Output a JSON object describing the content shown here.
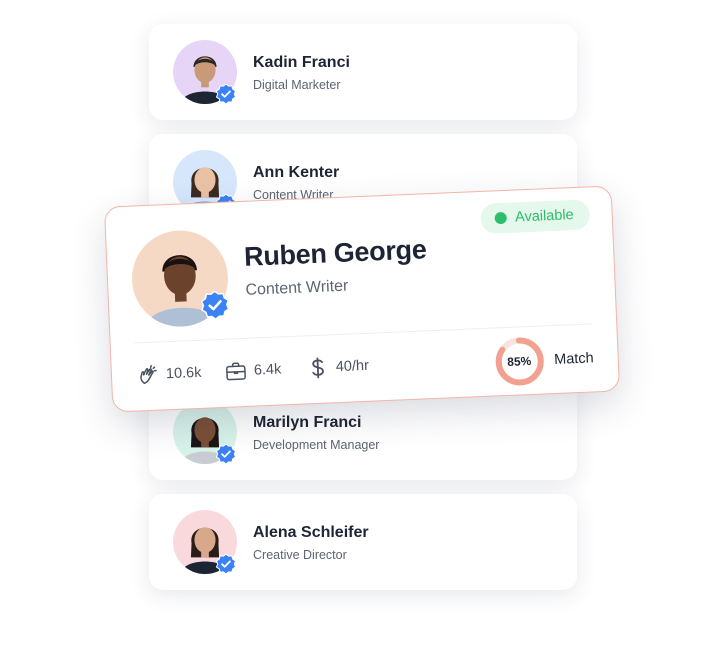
{
  "people": [
    {
      "name": "Kadin Franci",
      "role": "Digital Marketer",
      "avatar_bg": "#e6d5f7",
      "skin": "#c99a78",
      "hair": "#2a2424",
      "shirt": "#1d2433"
    },
    {
      "name": "Ann Kenter",
      "role": "Content Writer",
      "avatar_bg": "#d6e6fb",
      "skin": "#e9c2a5",
      "hair": "#3a2a22",
      "shirt": "#8c9bb1"
    },
    {
      "name": "Marilyn Franci",
      "role": "Development Manager",
      "avatar_bg": "#d8f3ea",
      "skin": "#7a5038",
      "hair": "#1a1414",
      "shirt": "#c9ccd2"
    },
    {
      "name": "Alena Schleifer",
      "role": "Creative Director",
      "avatar_bg": "#f9d9dc",
      "skin": "#d9a88a",
      "hair": "#2a1d18",
      "shirt": "#1d2433"
    }
  ],
  "featured": {
    "name": "Ruben George",
    "role": "Content Writer",
    "status": "Available",
    "stats": {
      "claps": "10.6k",
      "jobs": "6.4k",
      "rate": "40/hr"
    },
    "match_percent_label": "85%",
    "match_value": 0.85,
    "match_label": "Match",
    "avatar_bg": "#f6d9c5",
    "skin": "#6b432d",
    "hair": "#1a1210",
    "shirt": "#aebfd6"
  },
  "colors": {
    "verified_badge": "#3b82f6",
    "available_green": "#2ebd6b",
    "available_bg": "#e4f8ec",
    "match_ring": "#f2a08f",
    "match_track": "#fbe3dd",
    "featured_border": "#f2b5a8"
  },
  "icons": [
    "verified-badge-icon",
    "clap-icon",
    "briefcase-icon",
    "dollar-icon"
  ]
}
